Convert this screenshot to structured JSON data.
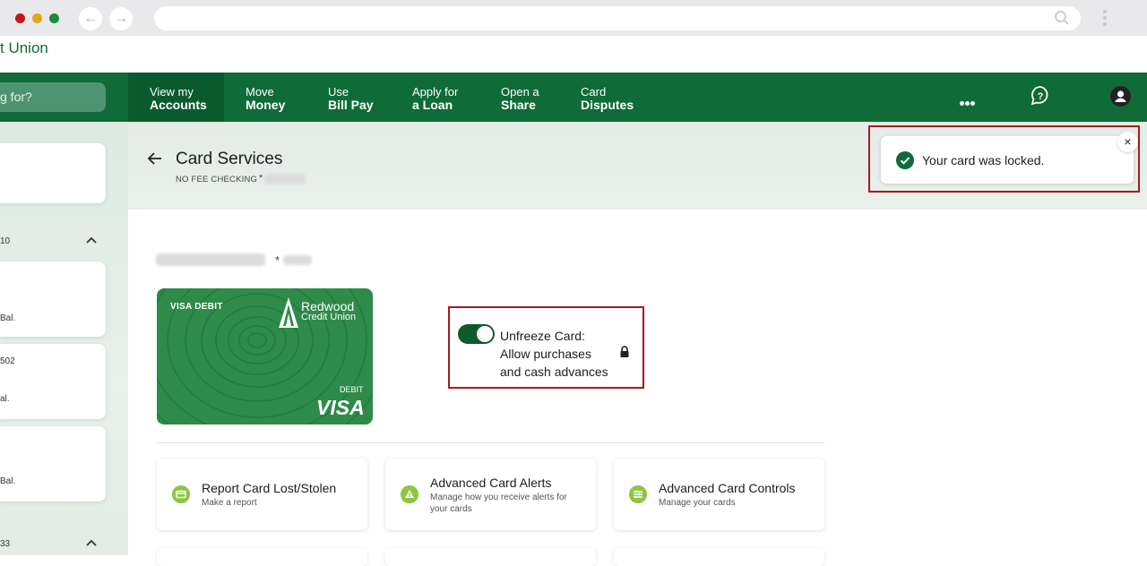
{
  "brand": {
    "partial_name": "t Union"
  },
  "search": {
    "placeholder": "g for?"
  },
  "nav": [
    {
      "line1": "View my",
      "line2": "Accounts",
      "active": true
    },
    {
      "line1": "Move",
      "line2": "Money"
    },
    {
      "line1": "Use",
      "line2": "Bill Pay"
    },
    {
      "line1": "Apply for",
      "line2": "a Loan"
    },
    {
      "line1": "Open a",
      "line2": "Share"
    },
    {
      "line1": "Card",
      "line2": "Disputes"
    }
  ],
  "sidebar": {
    "group1_label": "10",
    "group2_label": "33",
    "card1_text": "Bal.",
    "card2_top": "502",
    "card2_text": "al.",
    "card3_text": "Bal."
  },
  "header": {
    "title": "Card Services",
    "account_label": "NO FEE CHECKING",
    "account_star": "*"
  },
  "toast": {
    "message": "Your card was locked.",
    "close": "×"
  },
  "cardholder": {
    "star": "*"
  },
  "card": {
    "type_label": "VISA DEBIT",
    "brand_line1": "Redwood",
    "brand_line2": "Credit Union",
    "debit_label": "DEBIT",
    "network": "VISA"
  },
  "toggle": {
    "label_line1": "Unfreeze Card:",
    "label_line2": "Allow purchases",
    "label_line3": "and cash advances",
    "on": true
  },
  "tiles": [
    {
      "title": "Report Card Lost/Stolen",
      "subtitle": "Make a report",
      "icon": "card-icon"
    },
    {
      "title": "Advanced Card Alerts",
      "subtitle": "Manage how you receive alerts for your cards",
      "icon": "alert-icon"
    },
    {
      "title": "Advanced Card Controls",
      "subtitle": "Manage your cards",
      "icon": "controls-icon"
    }
  ],
  "colors": {
    "brand_green": "#0f6b37",
    "toast_check": "#0f6b37",
    "highlight_frame": "#a31c1c",
    "tile_icon": "#8dc641"
  }
}
